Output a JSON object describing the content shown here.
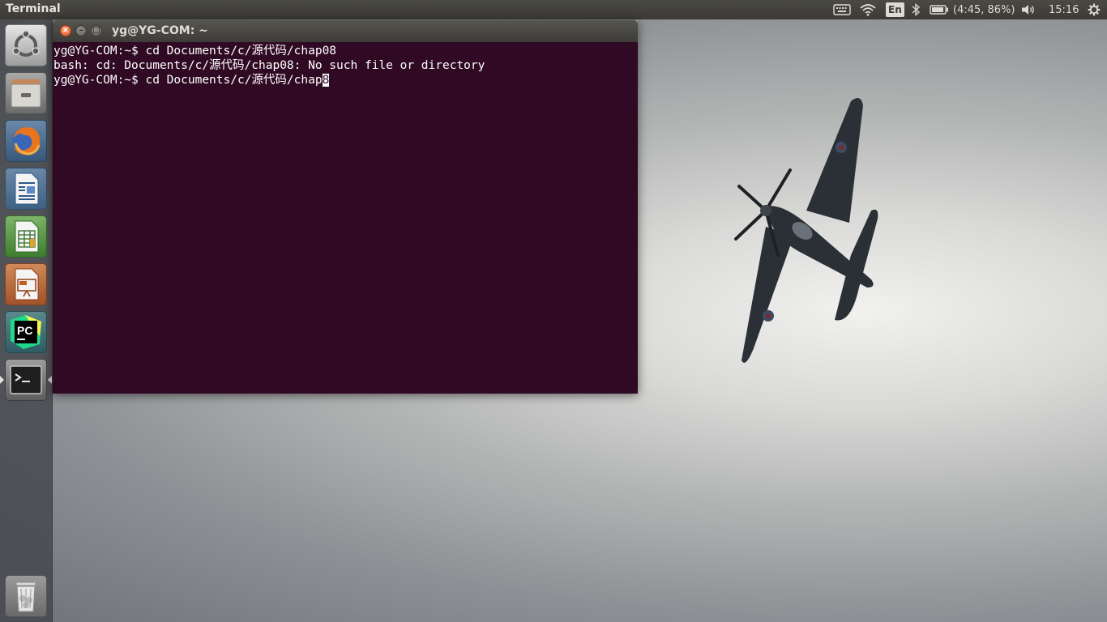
{
  "panel": {
    "app_title": "Terminal",
    "keyboard_icon": "keyboard-icon",
    "wifi_icon": "wifi-icon",
    "language": "En",
    "bluetooth_icon": "bluetooth-icon",
    "battery_icon": "battery-icon",
    "battery_text": "(4:45, 86%)",
    "volume_icon": "volume-icon",
    "clock": "15:16",
    "settings_icon": "gear-icon"
  },
  "launcher": {
    "items": [
      {
        "name": "Search your computer",
        "icon": "ubuntu-logo-icon"
      },
      {
        "name": "Files",
        "icon": "file-cabinet-icon"
      },
      {
        "name": "Firefox Web Browser",
        "icon": "firefox-icon"
      },
      {
        "name": "LibreOffice Writer",
        "icon": "writer-document-icon"
      },
      {
        "name": "LibreOffice Calc",
        "icon": "calc-spreadsheet-icon"
      },
      {
        "name": "LibreOffice Impress",
        "icon": "impress-presentation-icon"
      },
      {
        "name": "PyCharm",
        "icon": "pycharm-icon",
        "label": "PC"
      },
      {
        "name": "Terminal",
        "icon": "terminal-icon",
        "label": ">_",
        "active": true
      },
      {
        "name": "Trash",
        "icon": "trash-icon"
      }
    ]
  },
  "window": {
    "title": "yg@YG-COM: ~",
    "close_glyph": "×",
    "minimize_glyph": "–",
    "maximize_glyph": "□",
    "background": "#300a24"
  },
  "terminal": {
    "lines": [
      "yg@YG-COM:~$ cd Documents/c/源代码/chap08",
      "bash: cd: Documents/c/源代码/chap08: No such file or directory"
    ],
    "current_input": "yg@YG-COM:~$ cd Documents/c/源代码/chap",
    "cursor_char": "8"
  }
}
